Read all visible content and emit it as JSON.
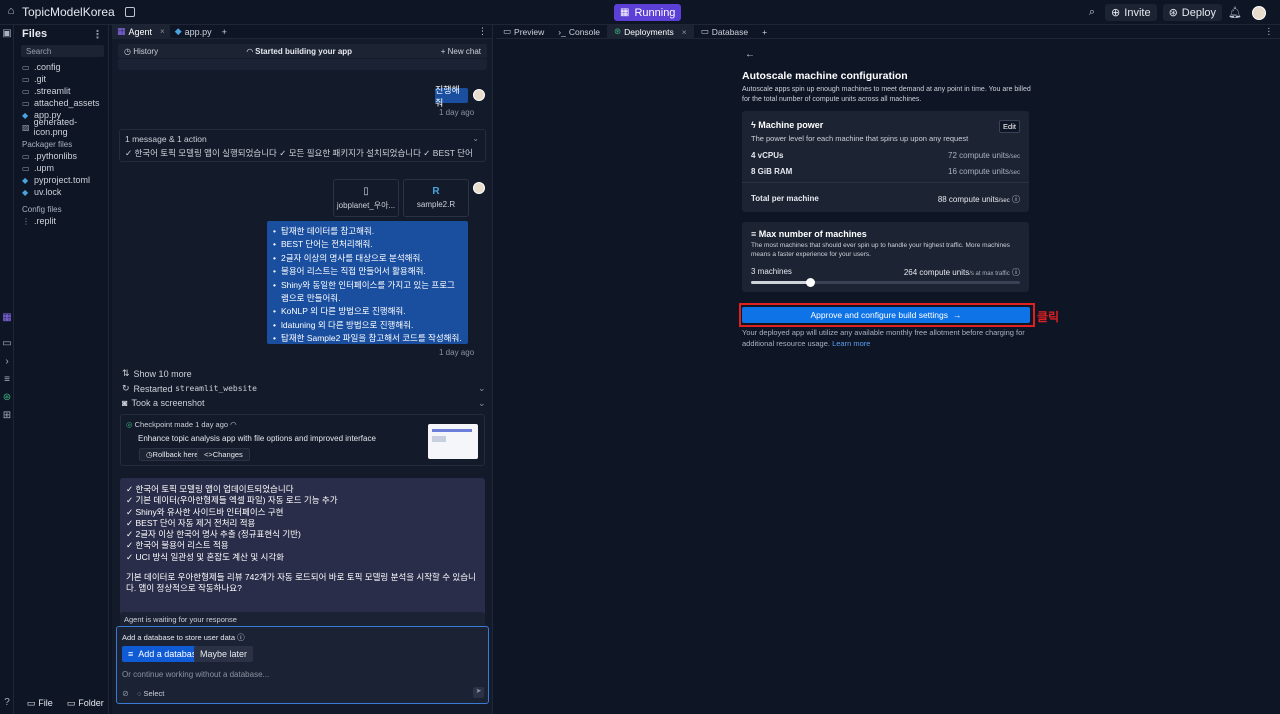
{
  "topbar": {
    "title": "TopicModelKorea",
    "status": "Running",
    "invite": "Invite",
    "deploy": "Deploy"
  },
  "files": {
    "header": "Files",
    "search_placeholder": "Search",
    "items": [
      ".config",
      ".git",
      ".streamlit",
      "attached_assets",
      "app.py",
      "generated-icon.png"
    ],
    "packager_header": "Packager files",
    "packager_items": [
      ".pythonlibs",
      ".upm",
      "pyproject.toml",
      "uv.lock"
    ],
    "config_header": "Config files",
    "config_items": [
      ".replit"
    ],
    "file_btn": "File",
    "folder_btn": "Folder"
  },
  "agent": {
    "tabs": [
      "Agent",
      "app.py"
    ],
    "history": "History",
    "status": "Started building your app",
    "new_chat": "New chat",
    "msg1": "진행해줘",
    "time1": "1 day ago",
    "action_title": "1 message & 1 action",
    "action_text": "✓ 한국어 토픽 모델링 앱이 실행되었습니다 ✓ 모든 필요한 패키지가 설치되었습니다 ✓ BEST 단어 제거 전처리가 포함되...",
    "attach1": "jobplanet_우아...",
    "attach2": "sample2.R",
    "list": [
      "탑재한 데이터를 참고해줘.",
      "BEST 단어는 전처리해줘.",
      "2글자 이상의 명사를 대상으로 분석해줘.",
      "불용어 리스트는 직접 만들어서 활용해줘.",
      "Shiny와 동일한 인터페이스를 가지고 있는 프로그램으로 만들어줘.",
      "KoNLP 외 다른 방법으로 진행해줘.",
      "ldatuning 외 다른 방법으로 진행해줘.",
      "탑재한 Sample2 파일을 참고해서 코드를 작성해줘."
    ],
    "time2": "1 day ago",
    "show_more": "Show 10 more",
    "restarted_label": "Restarted",
    "restarted_code": "streamlit_website",
    "screenshot": "Took a screenshot",
    "checkpoint": "Checkpoint made 1 day ago",
    "checkpoint_title": "Enhance topic analysis app with file options and improved interface",
    "rollback": "Rollback here",
    "changes": "Changes",
    "summary": [
      "✓ 한국어 토픽 모델링 앱이 업데이트되었습니다",
      "✓ 기본 데이터(우아한형제들 엑셀 파일) 자동 로드 기능 추가",
      "✓ Shiny와 유사한 사이드바 인터페이스 구현",
      "✓ BEST 단어 자동 제거 전처리 적용",
      "✓ 2글자 이상 한국어 명사 추출 (정규표현식 기반)",
      "✓ 한국어 불용어 리스트 적용",
      "✓ UCI 방식 일관성 및 혼잡도 계산 및 시각화"
    ],
    "summary_para": "기본 데이터로 우아한형제들 리뷰 742개가 자동 로드되어 바로 토픽 모델링 분석을 시작할 수 있습니다. 앱이 정상적으로 작동하나요?",
    "waiting": "Agent is waiting for your response",
    "db_prompt": "Add a database to store user data",
    "add_db": "Add a database",
    "maybe_later": "Maybe later",
    "continue_placeholder": "Or continue working without a database...",
    "select": "Select"
  },
  "right": {
    "tabs": [
      "Preview",
      "Console",
      "Deployments",
      "Database"
    ],
    "title": "Autoscale machine configuration",
    "desc": "Autoscale apps spin up enough machines to meet demand at any point in time. You are billed for the total number of compute units across all machines.",
    "mp_title": "Machine power",
    "mp_desc": "The power level for each machine that spins up upon any request",
    "edit": "Edit",
    "vcpu_label": "4 vCPUs",
    "vcpu_value": "72 compute units",
    "ram_label": "8 GiB RAM",
    "ram_value": "16 compute units",
    "per_sec": "/sec",
    "total_label": "Total per machine",
    "total_value": "88 compute units",
    "max_title": "Max number of machines",
    "max_desc": "The most machines that should ever spin up to handle your highest traffic. More machines means a faster experience for your users.",
    "machines_label": "3 machines",
    "machines_value": "264 compute units",
    "max_traffic": "/s at max traffic",
    "slider_fraction": 0.22,
    "approve": "Approve and configure build settings",
    "footer": "Your deployed app will utilize any available monthly free allotment before charging for additional resource usage.",
    "learn_more": "Learn more",
    "annotation": "클릭"
  }
}
